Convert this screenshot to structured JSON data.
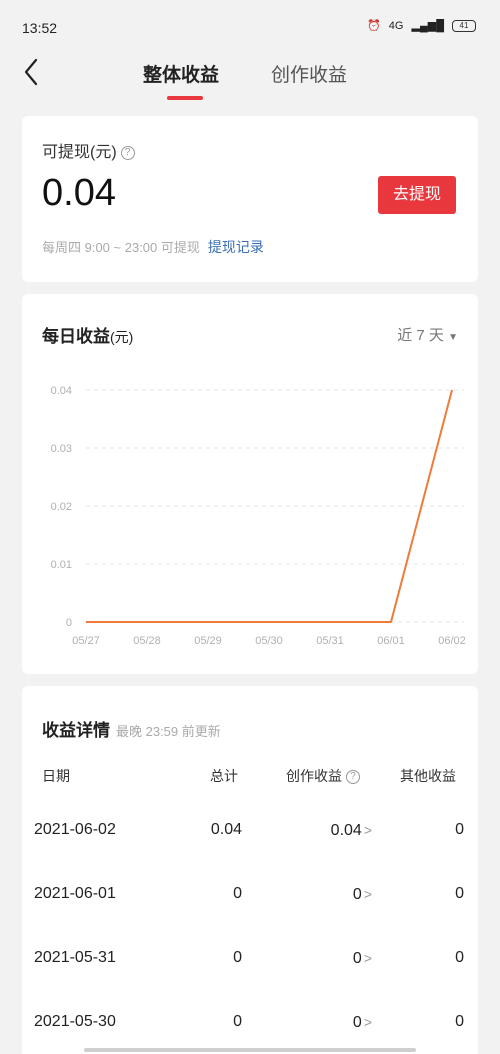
{
  "status_bar": {
    "time": "13:52",
    "net": "4G",
    "battery": "41"
  },
  "nav": {
    "tabs": [
      "整体收益",
      "创作收益"
    ]
  },
  "withdraw": {
    "label": "可提现(元)",
    "amount": "0.04",
    "button": "去提现",
    "note": "每周四 9:00 ~ 23:00 可提现",
    "record_link": "提现记录"
  },
  "daily": {
    "title": "每日收益",
    "unit": "(元)",
    "range": "近 7 天"
  },
  "chart_data": {
    "type": "line",
    "categories": [
      "05/27",
      "05/28",
      "05/29",
      "05/30",
      "05/31",
      "06/01",
      "06/02"
    ],
    "series": [
      {
        "values": [
          0,
          0,
          0,
          0,
          0,
          0,
          0.04
        ],
        "color": "#f07a3a"
      }
    ],
    "yticks": [
      "0",
      "0.01",
      "0.02",
      "0.03",
      "0.04"
    ],
    "ylim": [
      0,
      0.04
    ],
    "grid": true
  },
  "detail": {
    "title": "收益详情",
    "subtitle": "最晚 23:59 前更新",
    "columns": [
      "日期",
      "总计",
      "创作收益",
      "其他收益"
    ],
    "rows": [
      {
        "date": "2021-06-02",
        "total": "0.04",
        "creation": "0.04",
        "other": "0"
      },
      {
        "date": "2021-06-01",
        "total": "0",
        "creation": "0",
        "other": "0"
      },
      {
        "date": "2021-05-31",
        "total": "0",
        "creation": "0",
        "other": "0"
      },
      {
        "date": "2021-05-30",
        "total": "0",
        "creation": "0",
        "other": "0"
      }
    ]
  }
}
